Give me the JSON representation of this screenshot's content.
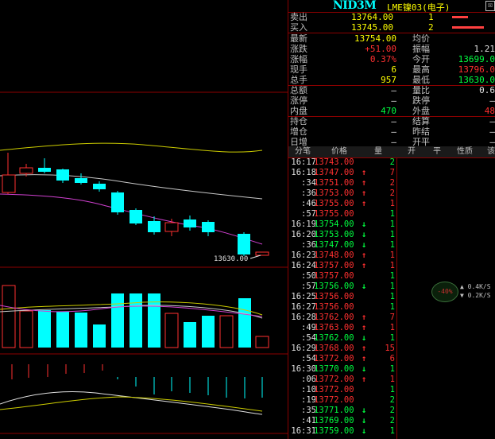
{
  "title": {
    "code": "NID3M",
    "name": "LME镍03(电子)",
    "close_glyph": "☒"
  },
  "chart": {
    "price_label": "13630.00"
  },
  "quote": {
    "sell": {
      "label": "卖出",
      "price": "13764.00",
      "vol": "1"
    },
    "buy": {
      "label": "买入",
      "price": "13745.00",
      "vol": "2"
    },
    "rows": [
      {
        "l1": "最新",
        "v1": "13754.00",
        "c1": "yellow",
        "l2": "均价",
        "v2": "",
        "c2": "white"
      },
      {
        "l1": "涨跌",
        "v1": "+51.00",
        "c1": "red",
        "l2": "振幅",
        "v2": "1.21",
        "c2": "white"
      },
      {
        "l1": "涨幅",
        "v1": "0.37%",
        "c1": "red",
        "l2": "今开",
        "v2": "13699.0",
        "c2": "green"
      },
      {
        "l1": "现手",
        "v1": "6",
        "c1": "yellow",
        "l2": "最高",
        "v2": "13796.0",
        "c2": "red"
      },
      {
        "l1": "总手",
        "v1": "957",
        "c1": "yellow",
        "l2": "最低",
        "v2": "13630.0",
        "c2": "green"
      },
      {
        "l1": "总额",
        "v1": "—",
        "c1": "white",
        "l2": "量比",
        "v2": "0.6",
        "c2": "white"
      },
      {
        "l1": "涨停",
        "v1": "—",
        "c1": "white",
        "l2": "跌停",
        "v2": "—",
        "c2": "white"
      },
      {
        "l1": "内盘",
        "v1": "470",
        "c1": "green",
        "l2": "外盘",
        "v2": "48",
        "c2": "red"
      },
      {
        "l1": "持仓",
        "v1": "—",
        "c1": "white",
        "l2": "结算",
        "v2": "—",
        "c2": "white"
      },
      {
        "l1": "增仓",
        "v1": "—",
        "c1": "white",
        "l2": "昨结",
        "v2": "—",
        "c2": "white"
      },
      {
        "l1": "日增",
        "v1": "—",
        "c1": "white",
        "l2": "开平",
        "v2": "—",
        "c2": "white"
      }
    ]
  },
  "tick_columns": [
    "分笔",
    "价格",
    "量",
    "开",
    "平",
    "性质",
    "该"
  ],
  "ticks": [
    {
      "time": "16:17",
      "price": "13743.00",
      "dir": "",
      "qty": "2",
      "qc": "green"
    },
    {
      "time": "16:18",
      "price": "13747.00",
      "dir": "up",
      "qty": "7",
      "qc": "red"
    },
    {
      "time": ":34",
      "price": "13751.00",
      "dir": "up",
      "qty": "2",
      "qc": "red"
    },
    {
      "time": ":36",
      "price": "13753.00",
      "dir": "up",
      "qty": "2",
      "qc": "red"
    },
    {
      "time": ":46",
      "price": "13755.00",
      "dir": "up",
      "qty": "1",
      "qc": "red"
    },
    {
      "time": ":57",
      "price": "13755.00",
      "dir": "",
      "qty": "1",
      "qc": "green"
    },
    {
      "time": "16:19",
      "price": "13754.00",
      "dir": "down",
      "qty": "1",
      "qc": "green"
    },
    {
      "time": "16:20",
      "price": "13753.00",
      "dir": "down",
      "qty": "1",
      "qc": "green"
    },
    {
      "time": ":36",
      "price": "13747.00",
      "dir": "down",
      "qty": "1",
      "qc": "green"
    },
    {
      "time": "16:23",
      "price": "13748.00",
      "dir": "up",
      "qty": "1",
      "qc": "red"
    },
    {
      "time": "16:24",
      "price": "13757.00",
      "dir": "up",
      "qty": "1",
      "qc": "red"
    },
    {
      "time": ":50",
      "price": "13757.00",
      "dir": "",
      "qty": "1",
      "qc": "green"
    },
    {
      "time": ":57",
      "price": "13756.00",
      "dir": "down",
      "qty": "1",
      "qc": "green"
    },
    {
      "time": "16:25",
      "price": "13756.00",
      "dir": "",
      "qty": "1",
      "qc": "green"
    },
    {
      "time": "16:27",
      "price": "13756.00",
      "dir": "",
      "qty": "1",
      "qc": "green"
    },
    {
      "time": "16:28",
      "price": "13762.00",
      "dir": "up",
      "qty": "7",
      "qc": "red"
    },
    {
      "time": ":49",
      "price": "13763.00",
      "dir": "up",
      "qty": "1",
      "qc": "red"
    },
    {
      "time": ":54",
      "price": "13762.00",
      "dir": "down",
      "qty": "1",
      "qc": "green"
    },
    {
      "time": "16:29",
      "price": "13768.00",
      "dir": "up",
      "qty": "15",
      "qc": "red"
    },
    {
      "time": ":54",
      "price": "13772.00",
      "dir": "up",
      "qty": "6",
      "qc": "red"
    },
    {
      "time": "16:30",
      "price": "13770.00",
      "dir": "down",
      "qty": "1",
      "qc": "green"
    },
    {
      "time": ":06",
      "price": "13772.00",
      "dir": "up",
      "qty": "1",
      "qc": "red"
    },
    {
      "time": ":10",
      "price": "13772.00",
      "dir": "",
      "qty": "1",
      "qc": "green"
    },
    {
      "time": ":19",
      "price": "13772.00",
      "dir": "",
      "qty": "2",
      "qc": "green"
    },
    {
      "time": ":35",
      "price": "13771.00",
      "dir": "down",
      "qty": "2",
      "qc": "green"
    },
    {
      "time": ":41",
      "price": "13769.00",
      "dir": "down",
      "qty": "2",
      "qc": "green"
    },
    {
      "time": "16:31",
      "price": "13759.00",
      "dir": "down",
      "qty": "1",
      "qc": "green"
    }
  ],
  "indicator": {
    "circle": "-40%",
    "a": "0.4K/S",
    "b": "0.2K/S"
  }
}
